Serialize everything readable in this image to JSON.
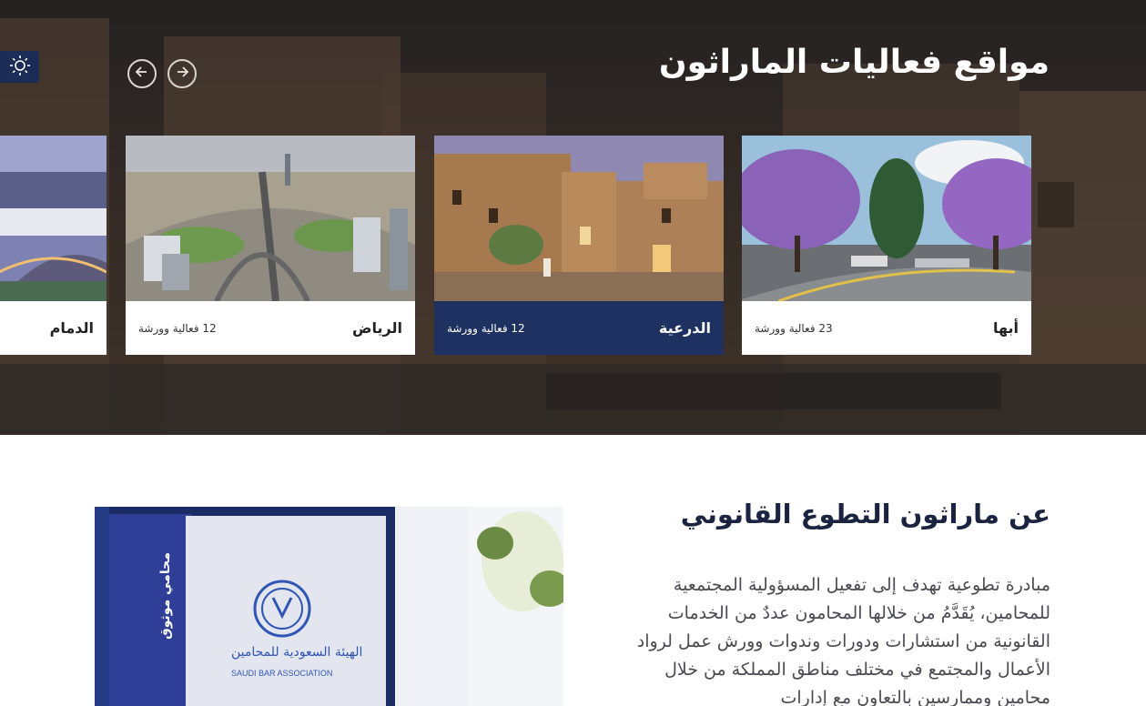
{
  "hero": {
    "title": "مواقع فعاليات الماراثون",
    "cards": [
      {
        "name": "أبها",
        "count": "23 فعالية وورشة"
      },
      {
        "name": "الدرعية",
        "count": "12 فعالية وورشة"
      },
      {
        "name": "الرياض",
        "count": "12 فعالية وورشة"
      },
      {
        "name": "الدمام",
        "count": ""
      }
    ]
  },
  "about": {
    "title": "عن ماراثون التطوع القانوني",
    "text": "مبادرة تطوعية تهدف إلى تفعيل المسؤولية المجتمعية للمحامين، يُقَدَّمُ من خلالها المحامون عددٌ من الخدمات القانونية من استشارات ودورات وندوات وورش عمل لرواد الأعمال والمجتمع في مختلف مناطق المملكة من خلال محامين وممارسين بالتعاون مع إدارات",
    "photo": {
      "logo_text": "الهيئة السعودية للمحامين",
      "logo_en": "SAUDI BAR ASSOCIATION",
      "badge_text": "محامي موثوق"
    }
  },
  "colors": {
    "navy": "#1e3160",
    "toggle": "#1b2d57",
    "title_dark": "#1a2440"
  },
  "icons": {
    "theme": "sun-icon",
    "prev": "arrow-left-icon",
    "next": "arrow-right-icon"
  }
}
